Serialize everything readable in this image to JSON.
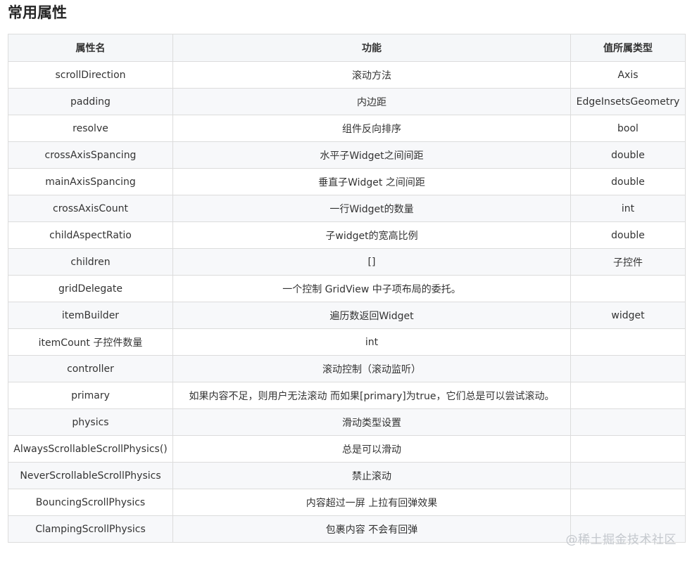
{
  "heading": "常用属性",
  "table": {
    "headers": [
      "属性名",
      "功能",
      "值所属类型"
    ],
    "rows": [
      [
        "scrollDirection",
        "滚动方法",
        "Axis"
      ],
      [
        "padding",
        "内边距",
        "EdgeInsetsGeometry"
      ],
      [
        "resolve",
        "组件反向排序",
        "bool"
      ],
      [
        "crossAxisSpancing",
        "水平子Widget之间间距",
        "double"
      ],
      [
        "mainAxisSpancing",
        "垂直子Widget 之间间距",
        "double"
      ],
      [
        "crossAxisCount",
        "一行Widget的数量",
        "int"
      ],
      [
        "childAspectRatio",
        "子widget的宽高比例",
        "double"
      ],
      [
        "children",
        "[]",
        "子控件"
      ],
      [
        "gridDelegate",
        "一个控制 GridView 中子项布局的委托。",
        ""
      ],
      [
        "itemBuilder",
        "遍历数返回Widget",
        "widget"
      ],
      [
        "itemCount 子控件数量",
        "int",
        ""
      ],
      [
        "controller",
        "滚动控制（滚动监听）",
        ""
      ],
      [
        "primary",
        "如果内容不足，则用户无法滚动 而如果[primary]为true，它们总是可以尝试滚动。",
        ""
      ],
      [
        "physics",
        "滑动类型设置",
        ""
      ],
      [
        "AlwaysScrollableScrollPhysics()",
        "总是可以滑动",
        ""
      ],
      [
        "NeverScrollableScrollPhysics",
        "禁止滚动",
        ""
      ],
      [
        "BouncingScrollPhysics",
        "内容超过一屏 上拉有回弹效果",
        ""
      ],
      [
        "ClampingScrollPhysics",
        "包裹内容 不会有回弹",
        ""
      ]
    ]
  },
  "watermark": "@稀土掘金技术社区"
}
